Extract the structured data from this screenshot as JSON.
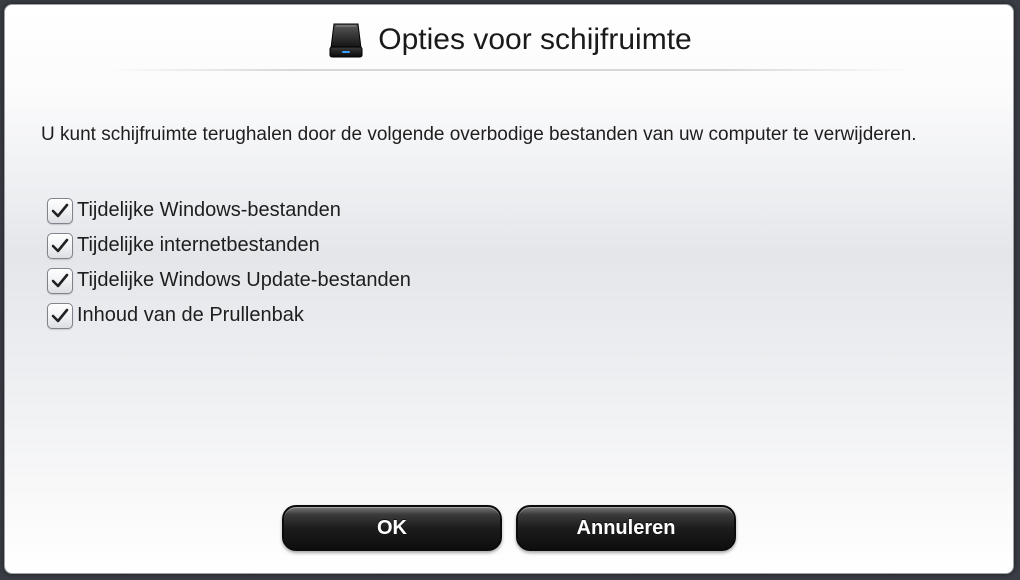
{
  "dialog": {
    "title": "Opties voor schijfruimte",
    "title_icon": "hard-drive-icon",
    "description": "U kunt schijfruimte terughalen door de volgende overbodige bestanden van uw computer te verwijderen.",
    "options": [
      {
        "label": "Tijdelijke Windows-bestanden",
        "checked": true
      },
      {
        "label": "Tijdelijke internetbestanden",
        "checked": true
      },
      {
        "label": "Tijdelijke Windows Update-bestanden",
        "checked": true
      },
      {
        "label": "Inhoud van de Prullenbak",
        "checked": true
      }
    ],
    "buttons": {
      "ok_label": "OK",
      "cancel_label": "Annuleren"
    }
  },
  "colors": {
    "button_bg": "#1c1c1c",
    "button_text": "#ffffff",
    "text": "#1e1e1e"
  }
}
